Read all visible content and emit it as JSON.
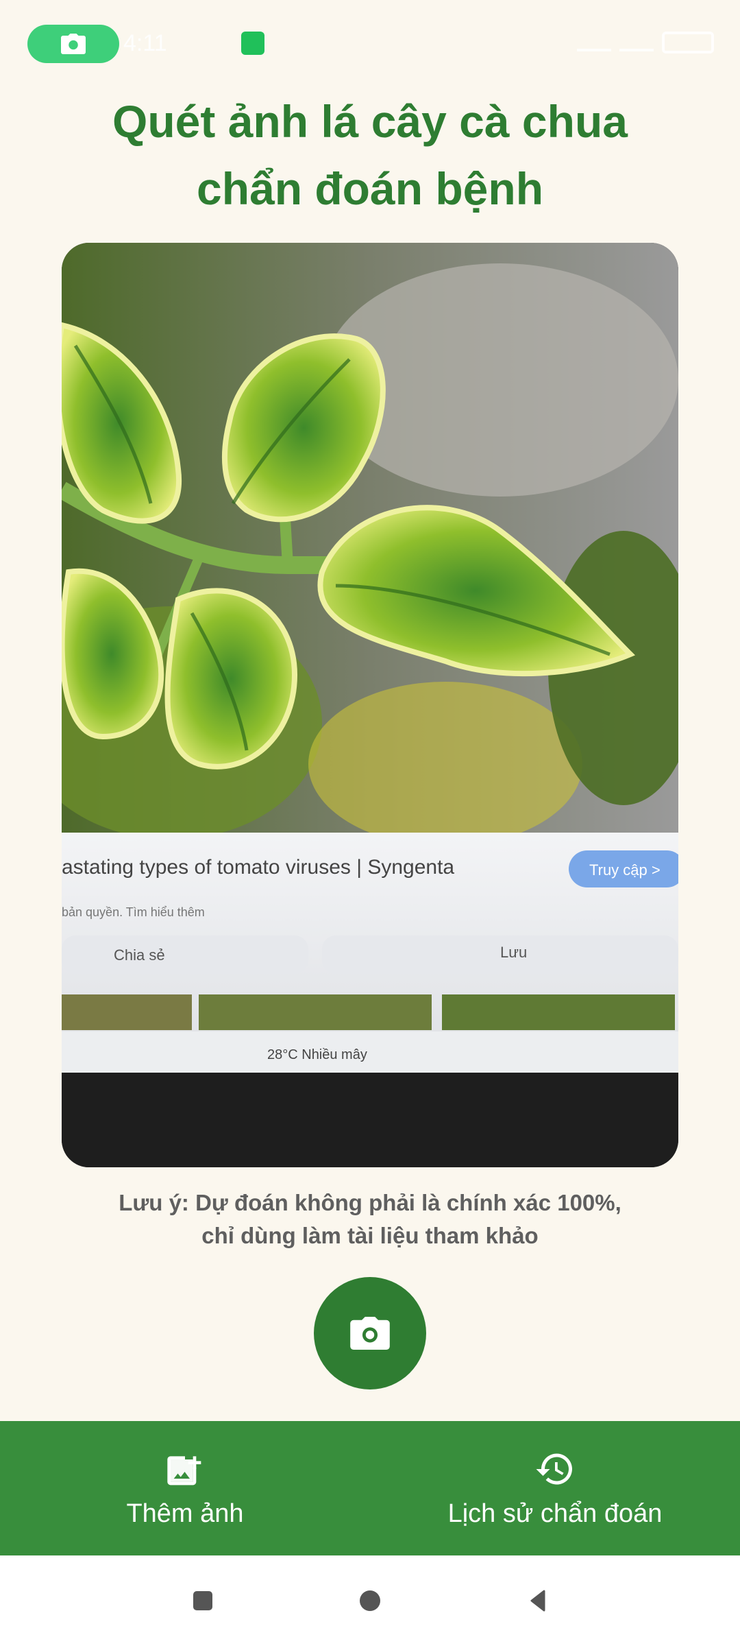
{
  "status_bar": {
    "time": "4:11",
    "camera_indicator": "camera-icon",
    "app_icon": "app-icon"
  },
  "title": {
    "line1": "Quét ảnh lá cây cà chua",
    "line2": "chẩn đoán bệnh"
  },
  "preview": {
    "screen_text": {
      "headline": "astating types of tomato viruses | Syngenta",
      "access_button": "Truy cập >",
      "copyright": "bản quyền. Tìm hiểu thêm",
      "share_label": "Chia sẻ",
      "save_label": "Lưu",
      "weather": "28°C  Nhiều mây"
    }
  },
  "notice": {
    "line1": "Lưu ý: Dự đoán không phải là chính xác 100%,",
    "line2": "chỉ dùng làm tài liệu tham khảo"
  },
  "camera_button": {
    "icon": "camera-icon"
  },
  "bottom_nav": {
    "items": [
      {
        "label": "Thêm ảnh",
        "icon": "add-photo-icon"
      },
      {
        "label": "Lịch sử chẩn đoán",
        "icon": "history-icon"
      }
    ]
  },
  "system_nav": {
    "items": [
      "recents-icon",
      "home-icon",
      "back-icon"
    ]
  },
  "colors": {
    "primary": "#2e7d32",
    "nav_bg": "#388e3c",
    "background": "#fbf7ee",
    "pill": "#3ecf7a"
  }
}
